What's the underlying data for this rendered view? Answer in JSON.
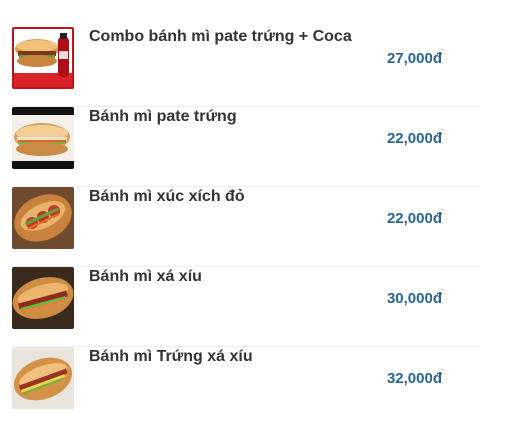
{
  "menu": {
    "items": [
      {
        "name": "Combo bánh mì pate trứng + Coca",
        "price": "27,000đ",
        "image_icon": "banh-mi-combo-coca-image"
      },
      {
        "name": "Bánh mì pate trứng",
        "price": "22,000đ",
        "image_icon": "banh-mi-pate-trung-image"
      },
      {
        "name": "Bánh mì xúc xích đỏ",
        "price": "22,000đ",
        "image_icon": "banh-mi-xuc-xich-do-image"
      },
      {
        "name": "Bánh mì xá xíu",
        "price": "30,000đ",
        "image_icon": "banh-mi-xa-xiu-image"
      },
      {
        "name": "Bánh mì Trứng xá xíu",
        "price": "32,000đ",
        "image_icon": "banh-mi-trung-xa-xiu-image"
      }
    ]
  },
  "colors": {
    "name_text": "#333333",
    "price_text": "#2a6496",
    "divider": "#eeeeee"
  }
}
